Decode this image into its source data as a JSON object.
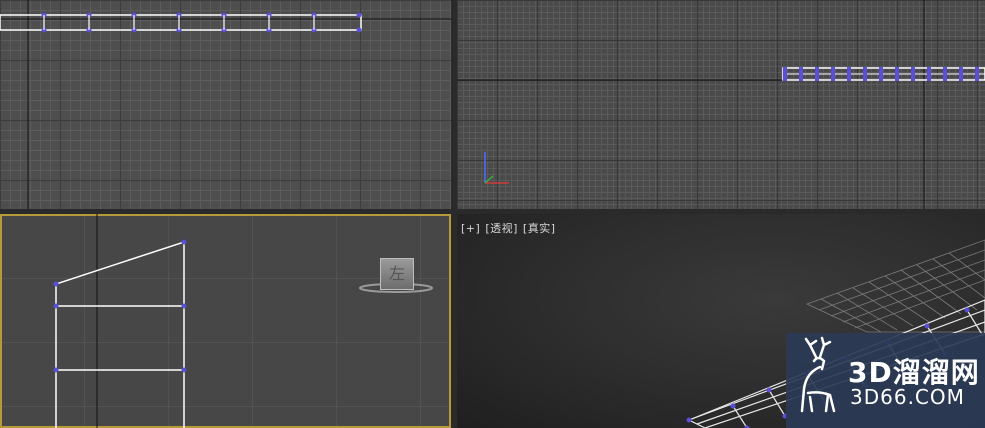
{
  "viewports": {
    "perspective": {
      "label_parts": [
        "[+]",
        "[透视]",
        "[真实]"
      ]
    },
    "left": {
      "viewcube_face": "左"
    }
  },
  "watermark": {
    "brand": "3D溜溜网",
    "url": "3D66.COM",
    "logo_icon": "deer-icon"
  },
  "colors": {
    "vertex": "#5a4fd6",
    "active_border": "#b59a3a",
    "watermark_bg": "#2a3956"
  }
}
